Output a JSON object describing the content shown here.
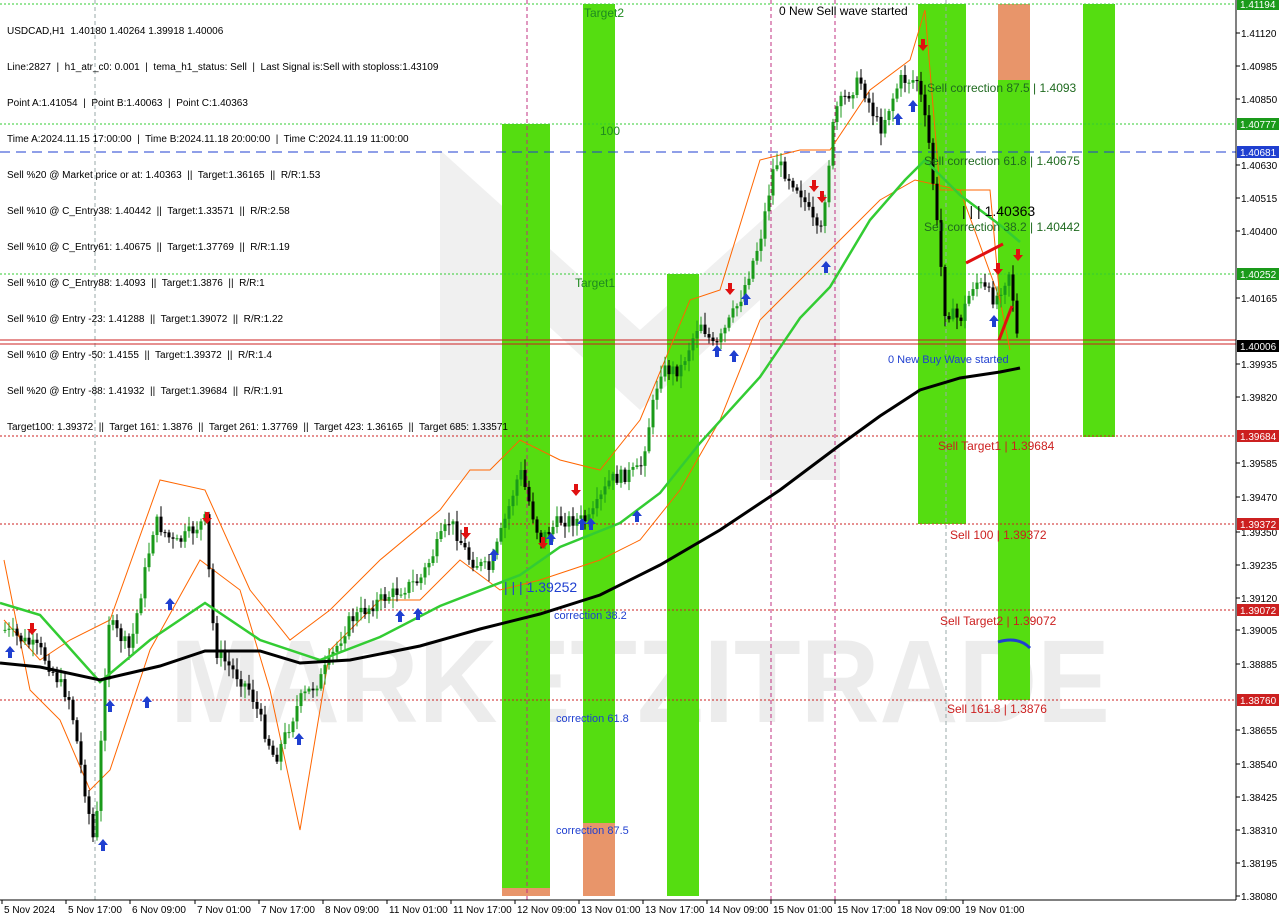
{
  "chart_data": {
    "type": "candlestick",
    "symbol": "USDCAD,H1",
    "ohlc_header": "USDCAD,H1  1.40180 1.40264 1.39918 1.40006",
    "info_lines": [
      "Line:2827  |  h1_atr_c0: 0.001  |  tema_h1_status: Sell  |  Last Signal is:Sell with stoploss:1.43109",
      "Point A:1.41054  |  Point B:1.40063  |  Point C:1.40363",
      "Time A:2024.11.15 17:00:00  |  Time B:2024.11.18 20:00:00  |  Time C:2024.11.19 11:00:00",
      "Sell %20 @ Market price or at: 1.40363  ||  Target:1.36165  ||  R/R:1.53",
      "Sell %10 @ C_Entry38: 1.40442  ||  Target:1.33571  ||  R/R:2.58",
      "Sell %10 @ C_Entry61: 1.40675  ||  Target:1.37769  ||  R/R:1.19",
      "Sell %10 @ C_Entry88: 1.4093  ||  Target:1.3876  ||  R/R:1",
      "Sell %10 @ Entry -23: 1.41288  ||  Target:1.39072  ||  R/R:1.22",
      "Sell %10 @ Entry -50: 1.4155  ||  Target:1.39372  ||  R/R:1.4",
      "Sell %20 @ Entry -88: 1.41932  ||  Target:1.39684  ||  R/R:1.91",
      "Target100: 1.39372  ||  Target 161: 1.3876  ||  Target 261: 1.37769  ||  Target 423: 1.36165  ||  Target 685: 1.33571"
    ],
    "y_ticks": [
      "1.41120",
      "1.40985",
      "1.40850",
      "1.40630",
      "1.40515",
      "1.40400",
      "1.40165",
      "1.39935",
      "1.39820",
      "1.39585",
      "1.39470",
      "1.39350",
      "1.39235",
      "1.39120",
      "1.39005",
      "1.38885",
      "1.38655",
      "1.38540",
      "1.38425",
      "1.38310",
      "1.38195",
      "1.38080"
    ],
    "x_ticks": [
      "5 Nov 2024",
      "5 Nov 17:00",
      "6 Nov 09:00",
      "7 Nov 01:00",
      "7 Nov 17:00",
      "8 Nov 09:00",
      "11 Nov 01:00",
      "11 Nov 17:00",
      "12 Nov 09:00",
      "13 Nov 01:00",
      "13 Nov 17:00",
      "14 Nov 09:00",
      "15 Nov 01:00",
      "15 Nov 17:00",
      "18 Nov 09:00",
      "19 Nov 01:00"
    ],
    "price_tags": [
      {
        "label": "1.41194",
        "color": "#1a9a1a"
      },
      {
        "label": "1.40777",
        "color": "#1a9a1a"
      },
      {
        "label": "1.40681",
        "color": "#1f3fd0"
      },
      {
        "label": "1.40252",
        "color": "#1a9a1a"
      },
      {
        "label": "1.40006",
        "color": "#000000"
      },
      {
        "label": "1.39684",
        "color": "#cc2020"
      },
      {
        "label": "1.39372",
        "color": "#cc2020"
      },
      {
        "label": "1.39072",
        "color": "#cc2020"
      },
      {
        "label": "1.38760",
        "color": "#cc2020"
      }
    ],
    "annotations": [
      {
        "text": "Target2",
        "color": "#1f8a1f"
      },
      {
        "text": "0 New Sell wave started",
        "color": "#000000"
      },
      {
        "text": "100",
        "color": "#1f8a1f"
      },
      {
        "text": "Sell correction 87.5 | 1.4093",
        "color": "#1f6a1f"
      },
      {
        "text": "Sell correction 61.8 | 1.40675",
        "color": "#1f6a1f"
      },
      {
        "text": "| | | 1.40363",
        "color": "#000000"
      },
      {
        "text": "Sell correction 38.2 | 1.40442",
        "color": "#1f6a1f"
      },
      {
        "text": "Target1",
        "color": "#1f8a1f"
      },
      {
        "text": "0 New Buy Wave started",
        "color": "#1f3fd0"
      },
      {
        "text": "Sell Target1 | 1.39684",
        "color": "#cc2020"
      },
      {
        "text": "Sell 100 | 1.39372",
        "color": "#cc2020"
      },
      {
        "text": "| | | 1.39252",
        "color": "#1f3fd0"
      },
      {
        "text": "correction 38.2",
        "color": "#1f3fd0"
      },
      {
        "text": "Sell Target2 | 1.39072",
        "color": "#cc2020"
      },
      {
        "text": "correction 61.8",
        "color": "#1f3fd0"
      },
      {
        "text": "Sell 161.8 | 1.3876",
        "color": "#cc2020"
      },
      {
        "text": "correction 87.5",
        "color": "#1f3fd0"
      }
    ],
    "watermark": "MARKETZITRADE",
    "colors": {
      "bull": "#1a9a1a",
      "bear": "#000000",
      "ma_fast": "#33cc33",
      "ma_slow": "#000000",
      "band": "#ff6600",
      "zone_green": "#55dd11",
      "zone_orange": "#e8956a",
      "sell_line": "#cc2020"
    }
  }
}
